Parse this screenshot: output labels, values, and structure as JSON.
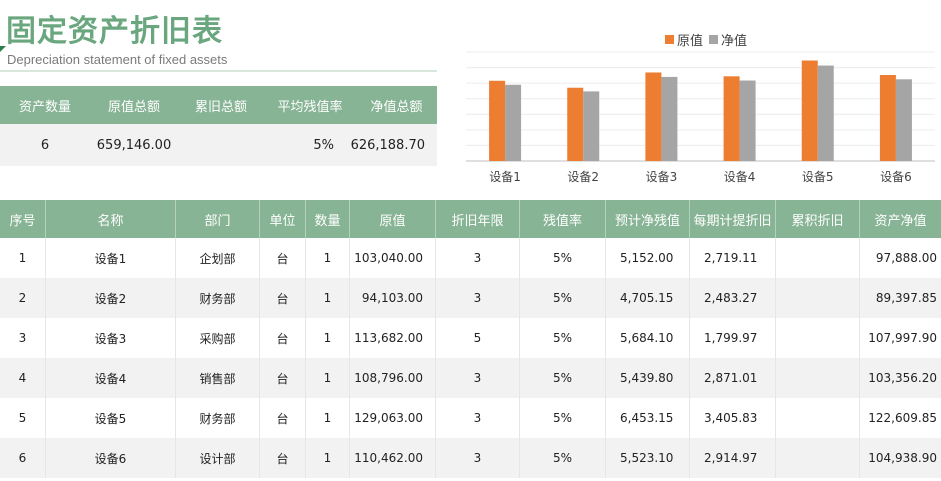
{
  "title": "固定资产折旧表",
  "subtitle": "Depreciation statement of fixed assets",
  "summary": {
    "headers": [
      "资产数量",
      "原值总额",
      "累旧总额",
      "平均残值率",
      "净值总额"
    ],
    "values": [
      "6",
      "659,146.00",
      "",
      "5%",
      "626,188.70"
    ]
  },
  "chart_data": {
    "type": "bar",
    "categories": [
      "设备1",
      "设备2",
      "设备3",
      "设备4",
      "设备5",
      "设备6"
    ],
    "series": [
      {
        "name": "原值",
        "color": "#ed7d31",
        "values": [
          103040.0,
          94103.0,
          113682.0,
          108796.0,
          129063.0,
          110462.0
        ]
      },
      {
        "name": "净值",
        "color": "#a5a5a5",
        "values": [
          97888.0,
          89397.85,
          107997.9,
          103356.2,
          122609.85,
          104938.9
        ]
      }
    ],
    "legend": "top",
    "grid": true
  },
  "table": {
    "headers": [
      "序号",
      "名称",
      "部门",
      "单位",
      "数量",
      "原值",
      "折旧年限",
      "残值率",
      "预计净残值",
      "每期计提折旧",
      "累积折旧",
      "资产净值"
    ],
    "rows": [
      [
        "1",
        "设备1",
        "企划部",
        "台",
        "1",
        "103,040.00",
        "3",
        "5%",
        "5,152.00",
        "2,719.11",
        "",
        "97,888.00"
      ],
      [
        "2",
        "设备2",
        "财务部",
        "台",
        "1",
        "94,103.00",
        "3",
        "5%",
        "4,705.15",
        "2,483.27",
        "",
        "89,397.85"
      ],
      [
        "3",
        "设备3",
        "采购部",
        "台",
        "1",
        "113,682.00",
        "5",
        "5%",
        "5,684.10",
        "1,799.97",
        "",
        "107,997.90"
      ],
      [
        "4",
        "设备4",
        "销售部",
        "台",
        "1",
        "108,796.00",
        "3",
        "5%",
        "5,439.80",
        "2,871.01",
        "",
        "103,356.20"
      ],
      [
        "5",
        "设备5",
        "财务部",
        "台",
        "1",
        "129,063.00",
        "3",
        "5%",
        "6,453.15",
        "3,405.83",
        "",
        "122,609.85"
      ],
      [
        "6",
        "设备6",
        "设计部",
        "台",
        "1",
        "110,462.00",
        "3",
        "5%",
        "5,523.10",
        "2,914.97",
        "",
        "104,938.90"
      ]
    ]
  }
}
